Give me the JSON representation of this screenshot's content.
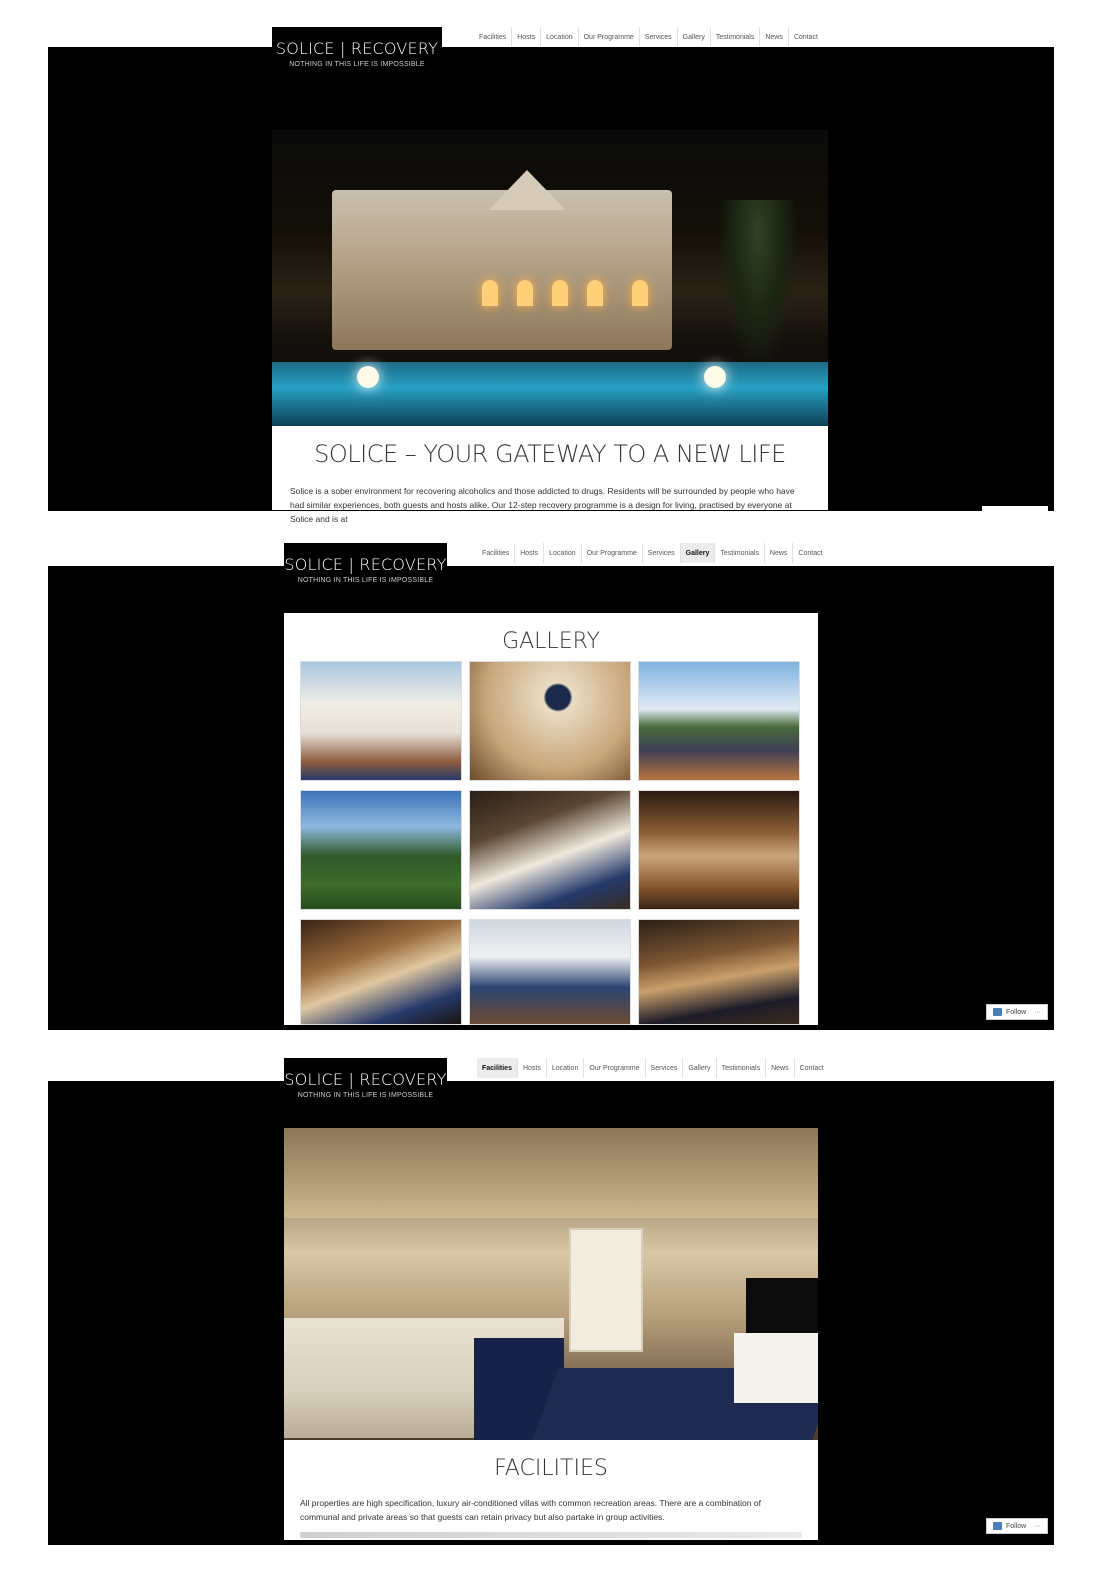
{
  "brand": {
    "title": "SOLICE | RECOVERY",
    "tagline": "NOTHING IN THIS LIFE IS IMPOSSIBLE"
  },
  "nav": {
    "items": [
      "Facilities",
      "Hosts",
      "Location",
      "Our Programme",
      "Services",
      "Gallery",
      "Testimonials",
      "News",
      "Contact"
    ]
  },
  "screen1": {
    "heading": "SOLICE – YOUR GATEWAY TO A NEW LIFE",
    "body": "Solice is a sober environment for recovering alcoholics and those addicted to drugs. Residents will be surrounded by people who have had similar experiences, both guests and hosts alike. Our 12-step recovery programme is a design for living, practised by everyone at Solice and is at"
  },
  "screen2": {
    "active_tab": "Gallery",
    "heading": "GALLERY",
    "thumbnails": 9
  },
  "screen3": {
    "active_tab": "Facilities",
    "heading": "FACILITIES",
    "body": "All properties are high specification, luxury air-conditioned villas with common recreation areas. There are a combination of communal and private areas so that guests can retain privacy but also partake in group activities."
  },
  "follow": {
    "label": "Follow",
    "more": "···"
  },
  "colors": {
    "frame_bg": "#000000",
    "card_bg": "#ffffff",
    "active_tab_bg": "#ececec"
  }
}
